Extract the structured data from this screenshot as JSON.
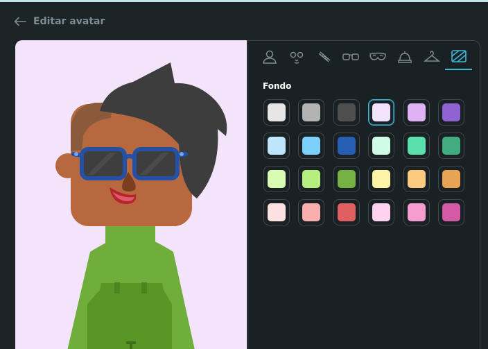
{
  "header": {
    "title": "Editar avatar"
  },
  "tabs": [
    {
      "icon": "person-outline-icon"
    },
    {
      "icon": "face-features-icon"
    },
    {
      "icon": "comb-icon"
    },
    {
      "icon": "glasses-icon"
    },
    {
      "icon": "mask-icon"
    },
    {
      "icon": "hat-icon"
    },
    {
      "icon": "hanger-icon"
    },
    {
      "icon": "background-frame-icon",
      "active": true
    }
  ],
  "background_section": {
    "title": "Fondo",
    "selected_color": "#f2e2fb",
    "colors": [
      "#e6e6e6",
      "#b3b3b3",
      "#4f4f4f",
      "#f2e2fb",
      "#dfb2f4",
      "#8f63d2",
      "#bfe5fd",
      "#7cd0fc",
      "#255eb2",
      "#d0fbe7",
      "#59e0ac",
      "#41ad7f",
      "#d8fcb1",
      "#b6ef7f",
      "#76b144",
      "#fff3a5",
      "#fdcb7f",
      "#e8a355",
      "#fde0e0",
      "#f9afae",
      "#e05f61",
      "#ffd3ef",
      "#f79ccf",
      "#d45aa6"
    ]
  },
  "avatar": {
    "background_color": "#f3e3fb",
    "skin_color": "#b8683f",
    "hair_color": "#3d3d3d",
    "glasses_color": "#2451a5",
    "shirt_color": "#6fae3a"
  }
}
